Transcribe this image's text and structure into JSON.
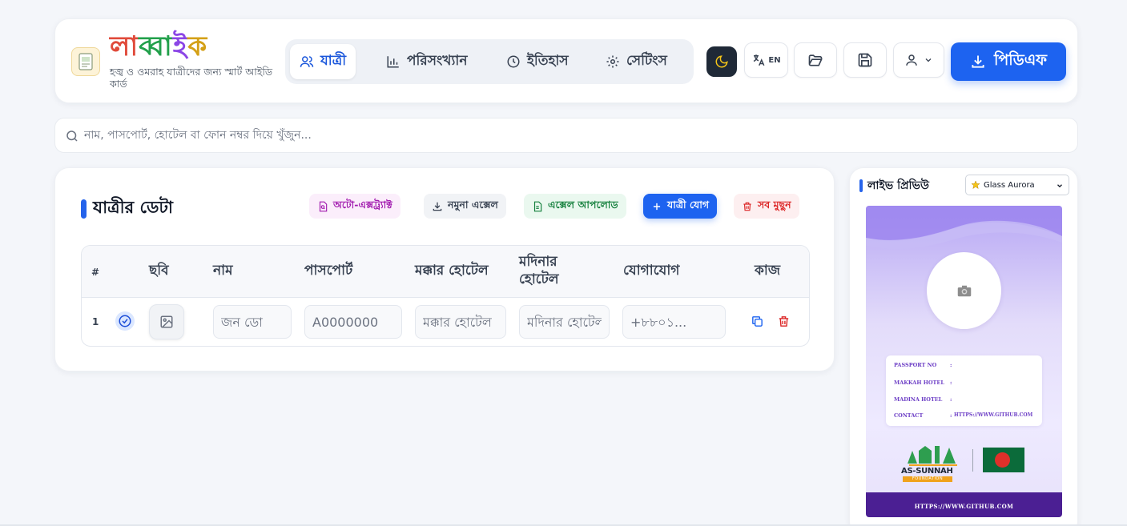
{
  "app": {
    "brand_chars": [
      "লা",
      "ব্বা",
      "ই",
      "ক"
    ],
    "tagline": "হজ্ব ও ওমরাহ যাত্রীদের জন্য স্মার্ট আইডি কার্ড"
  },
  "nav": {
    "tabs": [
      {
        "label": "যাত্রী",
        "icon": "users-icon",
        "active": true
      },
      {
        "label": "পরিসংখ্যান",
        "icon": "bar-chart-icon",
        "active": false
      },
      {
        "label": "ইতিহাস",
        "icon": "clock-icon",
        "active": false
      },
      {
        "label": "সেটিংস",
        "icon": "gear-icon",
        "active": false
      }
    ]
  },
  "toolbar": {
    "lang_label": "EN",
    "pdf_label": "পিডিএফ"
  },
  "search": {
    "placeholder": "নাম, পাসপোর্ট, হোটেল বা ফোন নম্বর দিয়ে খুঁজুন..."
  },
  "data_section": {
    "title": "যাত্রীর ডেটা",
    "actions": {
      "auto_extract": "অটো-এক্সট্র্যাক্ট",
      "sample_excel": "নমুনা এক্সেল",
      "excel_upload": "এক্সেল আপলোড",
      "add_passenger": "যাত্রী যোগ",
      "delete_all": "সব মুছুন"
    },
    "columns": [
      "#",
      "ছবি",
      "নাম",
      "পাসপোর্ট",
      "মক্কার হোটেল",
      "মদিনার হোটেল",
      "যোগাযোগ",
      "কাজ"
    ],
    "rows": [
      {
        "index": "1",
        "name_placeholder": "জন ডো",
        "passport_placeholder": "A0000000",
        "makkah_placeholder": "মক্কার হোটেল",
        "madina_placeholder": "মদিনার হোটেল",
        "contact_placeholder": "+৮৮০১..."
      }
    ]
  },
  "preview": {
    "title": "লাইভ প্রিভিউ",
    "theme_selected": "Glass Aurora",
    "card": {
      "fields": [
        {
          "label": "PASSPORT NO",
          "value": ""
        },
        {
          "label": "MAKKAH HOTEL",
          "value": ""
        },
        {
          "label": "MADINA HOTEL",
          "value": ""
        },
        {
          "label": "CONTACT",
          "value": "HTTPS://WWW.GITHUB.COM"
        }
      ],
      "org_name": "AS-SUNNAH",
      "org_sub": "FOUNDATION",
      "footer_url": "HTTPS://WWW.GITHUB.COM"
    }
  },
  "colors": {
    "primary": "#1d63f0",
    "card_purple": "#4b1f93",
    "danger": "#dc2626",
    "success": "#15803d"
  }
}
